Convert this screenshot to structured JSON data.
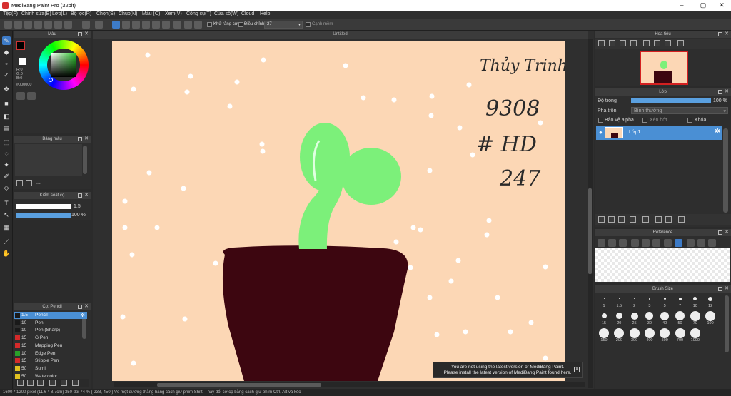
{
  "window": {
    "title": "MediBang Paint Pro (32bit)",
    "controls": {
      "minimize": "–",
      "maximize": "▢",
      "close": "✕"
    }
  },
  "menu": [
    "Tệp(F)",
    "Chỉnh sửa(E)",
    "Lớp(L)",
    "Bộ lọc(R)",
    "Chọn(S)",
    "Chụp(N)",
    "Màu (C)",
    "Xem(V)",
    "Công cụ(T)",
    "Cửa sổ(W)",
    "Cloud",
    "Help"
  ],
  "toolbar": {
    "antialias_label": "Khử răng cưa",
    "adjust_label": "Điều chỉnh",
    "adjust_value": "27",
    "edge_label": "Cạnh mềm"
  },
  "panels": {
    "color": {
      "title": "Màu",
      "r": "R:0",
      "g": "G:0",
      "b": "B:0",
      "hex": "#000000"
    },
    "palette": {
      "title": "Bảng màu",
      "more": "..."
    },
    "brush_control": {
      "title": "Kiểm soát cọ",
      "size": "1.5",
      "opacity": "100 %"
    },
    "brush_list": {
      "title": "Cọ: Pencil",
      "items": [
        {
          "size": "1.5",
          "name": "Pencil",
          "color": "#1a1a1a"
        },
        {
          "size": "10",
          "name": "Pen",
          "color": "#1a1a1a"
        },
        {
          "size": "10",
          "name": "Pen (Sharp)",
          "color": "#1a1a1a"
        },
        {
          "size": "15",
          "name": "G Pen",
          "color": "#d42a2a"
        },
        {
          "size": "15",
          "name": "Mapping Pen",
          "color": "#d42a2a"
        },
        {
          "size": "10",
          "name": "Edge Pen",
          "color": "#2aa02a"
        },
        {
          "size": "15",
          "name": "Stipple Pen",
          "color": "#d42a2a"
        },
        {
          "size": "50",
          "name": "Sumi",
          "color": "#e0c020"
        },
        {
          "size": "50",
          "name": "Watercolor",
          "color": "#e0c020"
        }
      ]
    },
    "navigator": {
      "title": "Hoa tiêu"
    },
    "layer": {
      "title": "Lớp",
      "opacity_label": "Độ trong",
      "opacity_value": "100 %",
      "opacity_level": 1.0,
      "blend_label": "Pha trộn",
      "blend_value": "Bình thường",
      "protect_alpha": "Bảo vệ alpha",
      "clipping": "Xén bớt",
      "lock": "Khóa",
      "layer_name": "Lớp1"
    },
    "reference": {
      "title": "Reference"
    },
    "brush_size": {
      "title": "Brush Size",
      "sizes": [
        "1",
        "1.5",
        "2",
        "3",
        "5",
        "7",
        "10",
        "12",
        "15",
        "20",
        "25",
        "30",
        "40",
        "50",
        "70",
        "100",
        "150",
        "200",
        "300",
        "400",
        "500",
        "700",
        "1000"
      ]
    }
  },
  "document": {
    "tab": "Untitled"
  },
  "canvas_text": {
    "line1": "Thủy Trinh",
    "line2": "9308",
    "line3": "# HD",
    "line4": "247"
  },
  "status": "1600 * 1200 pixel   (11.6 * 8.7cm)   350 dpi   74 %   ( 238, 450 )   Vẽ một đường thẳng bằng cách giữ phím Shift. Thay đổi cỡ cọ bằng cách giữ phím Ctrl, Alt và kéo",
  "notification": {
    "line1": "You are not using the latest version of MediBang Paint.",
    "line2": "Please install the latest version of MediBang Paint found here.",
    "close": "X"
  },
  "colors": {
    "accent": "#4a8fd4",
    "paper": "#fcd7b5",
    "pot": "#3d0610",
    "sprout": "#7cf07a"
  }
}
